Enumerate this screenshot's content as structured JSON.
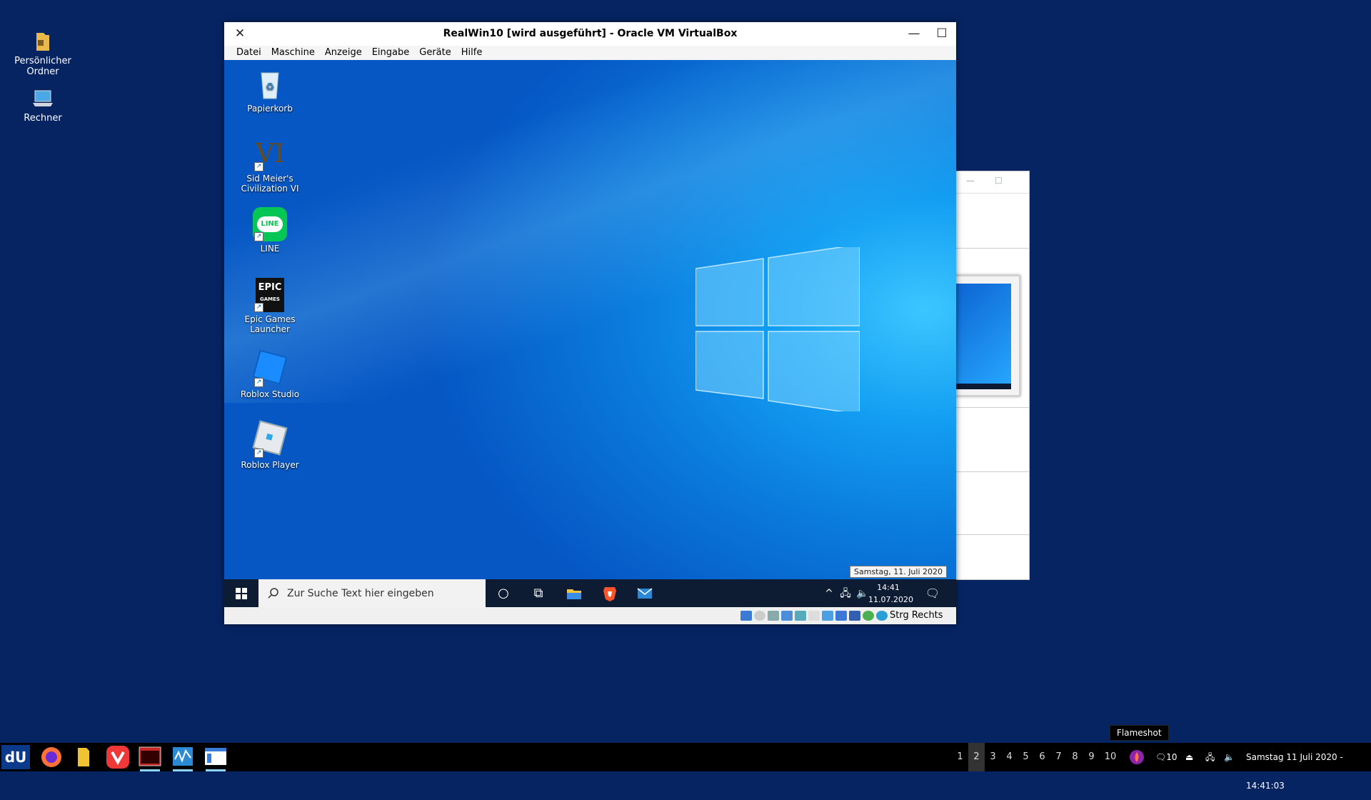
{
  "host_desktop": {
    "icons": [
      {
        "label": "Persönlicher\nOrdner",
        "icon": "folder-home-icon"
      },
      {
        "label": "Rechner",
        "icon": "computer-icon"
      }
    ]
  },
  "vbox_window": {
    "title": "RealWin10 [wird ausgeführt] - Oracle VM VirtualBox",
    "menu": [
      "Datei",
      "Maschine",
      "Anzeige",
      "Eingabe",
      "Geräte",
      "Hilfe"
    ],
    "status_host_key": "Strg Rechts"
  },
  "guest_desktop": {
    "icons": [
      {
        "label": "Papierkorb",
        "icon": "recycle-bin-icon"
      },
      {
        "label": "Sid Meier's Civilization VI",
        "icon": "civilization-icon"
      },
      {
        "label": "LINE",
        "icon": "line-icon"
      },
      {
        "label": "Epic Games Launcher",
        "icon": "epic-games-icon"
      },
      {
        "label": "Roblox Studio",
        "icon": "roblox-studio-icon"
      },
      {
        "label": "Roblox Player",
        "icon": "roblox-player-icon"
      }
    ],
    "tooltip": "Samstag, 11. Juli 2020",
    "taskbar": {
      "search_placeholder": "Zur Suche Text hier eingeben",
      "time": "14:41",
      "date": "11.07.2020"
    }
  },
  "host_panel": {
    "workspaces": [
      "1",
      "2",
      "3",
      "4",
      "5",
      "6",
      "7",
      "8",
      "9",
      "10"
    ],
    "current_workspace": "2",
    "flameshot_tooltip": "Flameshot",
    "notification_count": "10",
    "datetime": "Samstag 11 Juli 2020 - 14:41:03"
  },
  "colors": {
    "host_bg": "#062462",
    "win10_taskbar": "#0d1b33",
    "panel_bg": "#000000"
  }
}
